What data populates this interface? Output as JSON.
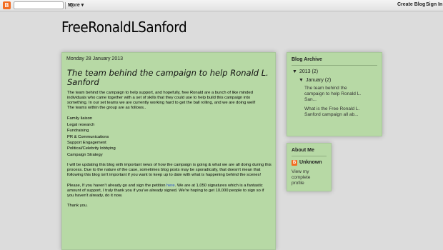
{
  "navbar": {
    "logo_glyph": "B",
    "search_glyph": "Q",
    "more_label": "More ▾",
    "create_blog": "Create Blog",
    "sign_in": "Sign In"
  },
  "blog": {
    "title": "FreeRonaldLSanford"
  },
  "post": {
    "date": "Monday 28 January 2013",
    "title": "The team behind the campaign to help Ronald L. Sanford",
    "para1": "The team behind the campaign to help support, and hopefully, free Ronald are a bunch of like minded individuals who came together with a set of skills that they could use to help build this campaign into something. In our set teams we are currently working hard to get the ball rolling, and we are doing well!",
    "teams_intro": "The teams within the group are as follows..",
    "teams": [
      "Family liaison",
      "Legal research",
      "Fundraising",
      "PR & Communications",
      "Support Engagement",
      "Political/Celebrity lobbying",
      "Campaign Strategy"
    ],
    "para2": "I will be updating this blog with important news of how the campaign is going & what we are all doing during this process. Due to the nature of the case, sometimes blog posts may be sporadically, that doesn't mean that following this blog isn't important if you want to keep up to date with what is happening behind the scenes!",
    "para3_before": "Please, If you haven't already go and sign the petition ",
    "para3_link": "here",
    "para3_after": ". We are at 1,050 signatures which is a fantastic amount of support, I truly thank you if you've already signed. We're hoping to get 10,000 people to sign so if you haven't already, do it now.",
    "thanks": "Thank you."
  },
  "archive": {
    "title": "Blog Archive",
    "year": "2013",
    "year_count": "(2)",
    "month": "January",
    "month_count": "(2)",
    "posts": [
      "The team behind the campaign to help Ronald L. San...",
      "What is the Free Ronald L. Sanford campaign all ab..."
    ]
  },
  "about": {
    "title": "About Me",
    "name": "Unknown",
    "profile_link": "View my complete profile"
  }
}
